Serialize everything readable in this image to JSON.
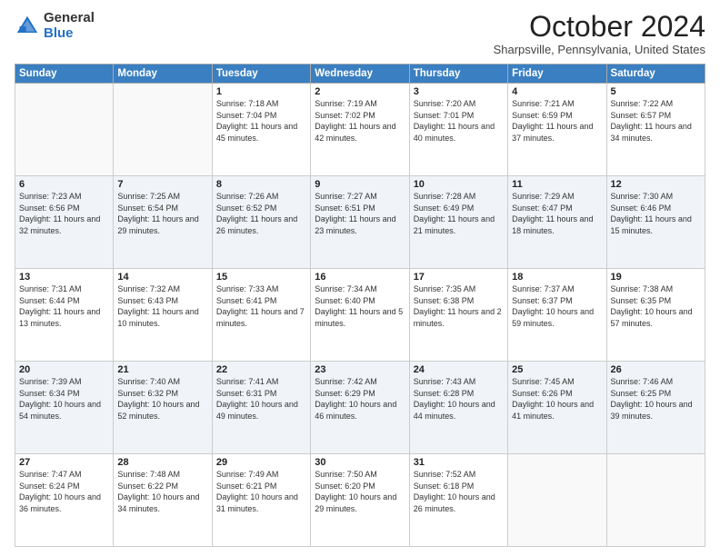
{
  "logo": {
    "general": "General",
    "blue": "Blue"
  },
  "header": {
    "month": "October 2024",
    "location": "Sharpsville, Pennsylvania, United States"
  },
  "weekdays": [
    "Sunday",
    "Monday",
    "Tuesday",
    "Wednesday",
    "Thursday",
    "Friday",
    "Saturday"
  ],
  "weeks": [
    [
      {
        "day": "",
        "info": ""
      },
      {
        "day": "",
        "info": ""
      },
      {
        "day": "1",
        "info": "Sunrise: 7:18 AM\nSunset: 7:04 PM\nDaylight: 11 hours and 45 minutes."
      },
      {
        "day": "2",
        "info": "Sunrise: 7:19 AM\nSunset: 7:02 PM\nDaylight: 11 hours and 42 minutes."
      },
      {
        "day": "3",
        "info": "Sunrise: 7:20 AM\nSunset: 7:01 PM\nDaylight: 11 hours and 40 minutes."
      },
      {
        "day": "4",
        "info": "Sunrise: 7:21 AM\nSunset: 6:59 PM\nDaylight: 11 hours and 37 minutes."
      },
      {
        "day": "5",
        "info": "Sunrise: 7:22 AM\nSunset: 6:57 PM\nDaylight: 11 hours and 34 minutes."
      }
    ],
    [
      {
        "day": "6",
        "info": "Sunrise: 7:23 AM\nSunset: 6:56 PM\nDaylight: 11 hours and 32 minutes."
      },
      {
        "day": "7",
        "info": "Sunrise: 7:25 AM\nSunset: 6:54 PM\nDaylight: 11 hours and 29 minutes."
      },
      {
        "day": "8",
        "info": "Sunrise: 7:26 AM\nSunset: 6:52 PM\nDaylight: 11 hours and 26 minutes."
      },
      {
        "day": "9",
        "info": "Sunrise: 7:27 AM\nSunset: 6:51 PM\nDaylight: 11 hours and 23 minutes."
      },
      {
        "day": "10",
        "info": "Sunrise: 7:28 AM\nSunset: 6:49 PM\nDaylight: 11 hours and 21 minutes."
      },
      {
        "day": "11",
        "info": "Sunrise: 7:29 AM\nSunset: 6:47 PM\nDaylight: 11 hours and 18 minutes."
      },
      {
        "day": "12",
        "info": "Sunrise: 7:30 AM\nSunset: 6:46 PM\nDaylight: 11 hours and 15 minutes."
      }
    ],
    [
      {
        "day": "13",
        "info": "Sunrise: 7:31 AM\nSunset: 6:44 PM\nDaylight: 11 hours and 13 minutes."
      },
      {
        "day": "14",
        "info": "Sunrise: 7:32 AM\nSunset: 6:43 PM\nDaylight: 11 hours and 10 minutes."
      },
      {
        "day": "15",
        "info": "Sunrise: 7:33 AM\nSunset: 6:41 PM\nDaylight: 11 hours and 7 minutes."
      },
      {
        "day": "16",
        "info": "Sunrise: 7:34 AM\nSunset: 6:40 PM\nDaylight: 11 hours and 5 minutes."
      },
      {
        "day": "17",
        "info": "Sunrise: 7:35 AM\nSunset: 6:38 PM\nDaylight: 11 hours and 2 minutes."
      },
      {
        "day": "18",
        "info": "Sunrise: 7:37 AM\nSunset: 6:37 PM\nDaylight: 10 hours and 59 minutes."
      },
      {
        "day": "19",
        "info": "Sunrise: 7:38 AM\nSunset: 6:35 PM\nDaylight: 10 hours and 57 minutes."
      }
    ],
    [
      {
        "day": "20",
        "info": "Sunrise: 7:39 AM\nSunset: 6:34 PM\nDaylight: 10 hours and 54 minutes."
      },
      {
        "day": "21",
        "info": "Sunrise: 7:40 AM\nSunset: 6:32 PM\nDaylight: 10 hours and 52 minutes."
      },
      {
        "day": "22",
        "info": "Sunrise: 7:41 AM\nSunset: 6:31 PM\nDaylight: 10 hours and 49 minutes."
      },
      {
        "day": "23",
        "info": "Sunrise: 7:42 AM\nSunset: 6:29 PM\nDaylight: 10 hours and 46 minutes."
      },
      {
        "day": "24",
        "info": "Sunrise: 7:43 AM\nSunset: 6:28 PM\nDaylight: 10 hours and 44 minutes."
      },
      {
        "day": "25",
        "info": "Sunrise: 7:45 AM\nSunset: 6:26 PM\nDaylight: 10 hours and 41 minutes."
      },
      {
        "day": "26",
        "info": "Sunrise: 7:46 AM\nSunset: 6:25 PM\nDaylight: 10 hours and 39 minutes."
      }
    ],
    [
      {
        "day": "27",
        "info": "Sunrise: 7:47 AM\nSunset: 6:24 PM\nDaylight: 10 hours and 36 minutes."
      },
      {
        "day": "28",
        "info": "Sunrise: 7:48 AM\nSunset: 6:22 PM\nDaylight: 10 hours and 34 minutes."
      },
      {
        "day": "29",
        "info": "Sunrise: 7:49 AM\nSunset: 6:21 PM\nDaylight: 10 hours and 31 minutes."
      },
      {
        "day": "30",
        "info": "Sunrise: 7:50 AM\nSunset: 6:20 PM\nDaylight: 10 hours and 29 minutes."
      },
      {
        "day": "31",
        "info": "Sunrise: 7:52 AM\nSunset: 6:18 PM\nDaylight: 10 hours and 26 minutes."
      },
      {
        "day": "",
        "info": ""
      },
      {
        "day": "",
        "info": ""
      }
    ]
  ]
}
